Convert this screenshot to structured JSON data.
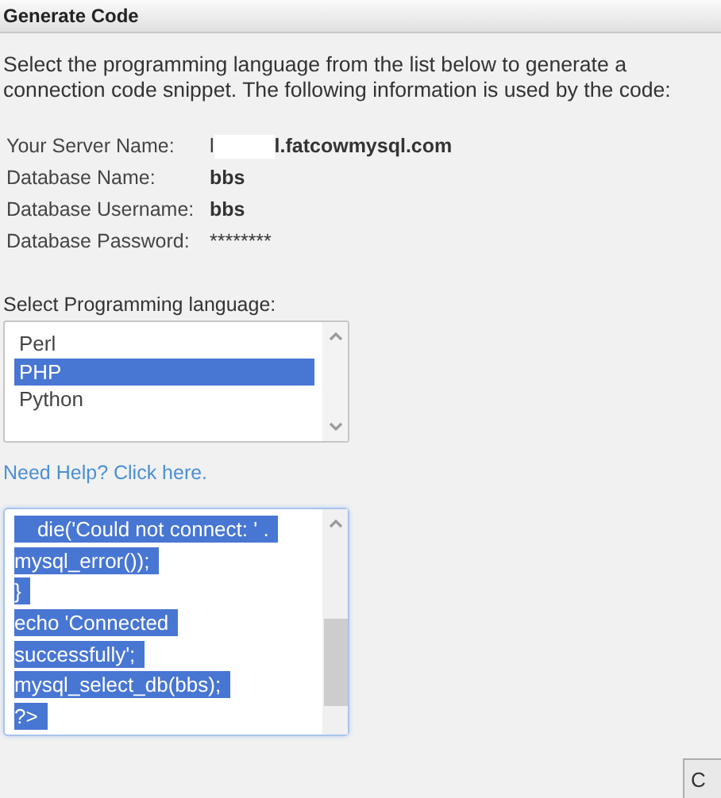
{
  "header": {
    "title": "Generate Code"
  },
  "description": "Select the programming language from the list below to generate a connection code snippet. The following information is used by the code:",
  "info": [
    {
      "label": "Your Server Name:",
      "value_prefix": "l",
      "redacted": true,
      "value": "l.fatcowmysql.com"
    },
    {
      "label": "Database Name:",
      "value": "bbs"
    },
    {
      "label": "Database Username:",
      "value": "bbs"
    },
    {
      "label": "Database Password:",
      "value": "********"
    }
  ],
  "language_label": "Select Programming language:",
  "languages": [
    {
      "label": "Perl",
      "selected": false
    },
    {
      "label": "PHP",
      "selected": true
    },
    {
      "label": "Python",
      "selected": false
    }
  ],
  "help_link": "Need Help? Click here.",
  "code": {
    "selected": true,
    "lines": [
      "    die('Could not connect: ' .",
      "mysql_error());",
      "}",
      "echo 'Connected",
      "successfully';",
      "mysql_select_db(bbs);",
      "?>"
    ]
  },
  "button": "C"
}
